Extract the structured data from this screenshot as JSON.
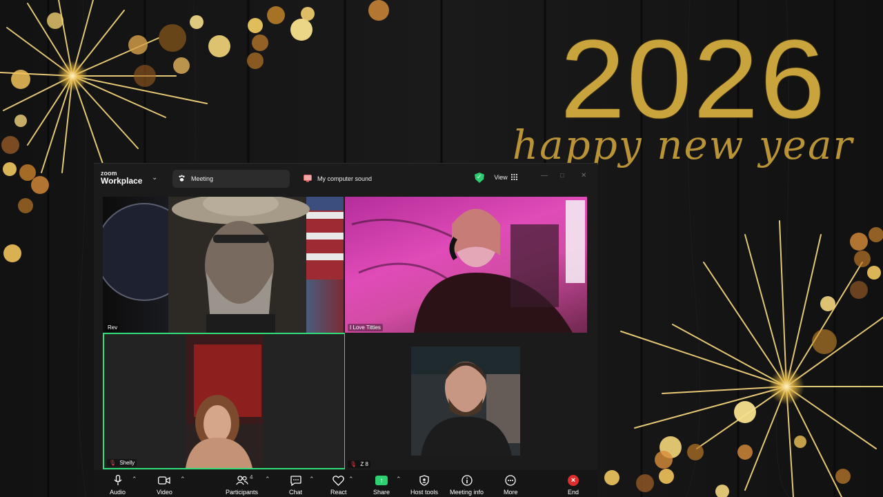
{
  "background": {
    "year": "2026",
    "greeting": "happy new year",
    "colors": {
      "gold": "#c9a43c",
      "wood": "#161616"
    }
  },
  "window": {
    "logo_line1": "zoom",
    "logo_line2": "Workplace",
    "tab_meeting": "Meeting",
    "tab_sound": "My computer sound",
    "view_label": "View"
  },
  "participants": [
    {
      "name": "Rev",
      "muted": false
    },
    {
      "name": "I Love Titties",
      "muted": false
    },
    {
      "name": "Shelly",
      "muted": true,
      "active_speaker": true
    },
    {
      "name": "Z 8",
      "muted": true
    }
  ],
  "toolbar": {
    "audio": "Audio",
    "video": "Video",
    "participants": "Participants",
    "participant_count": "4",
    "chat": "Chat",
    "react": "React",
    "share": "Share",
    "host_tools": "Host tools",
    "meeting_info": "Meeting info",
    "more": "More",
    "end": "End",
    "accent": "#2fe07a",
    "end_color": "#e02d2d"
  }
}
